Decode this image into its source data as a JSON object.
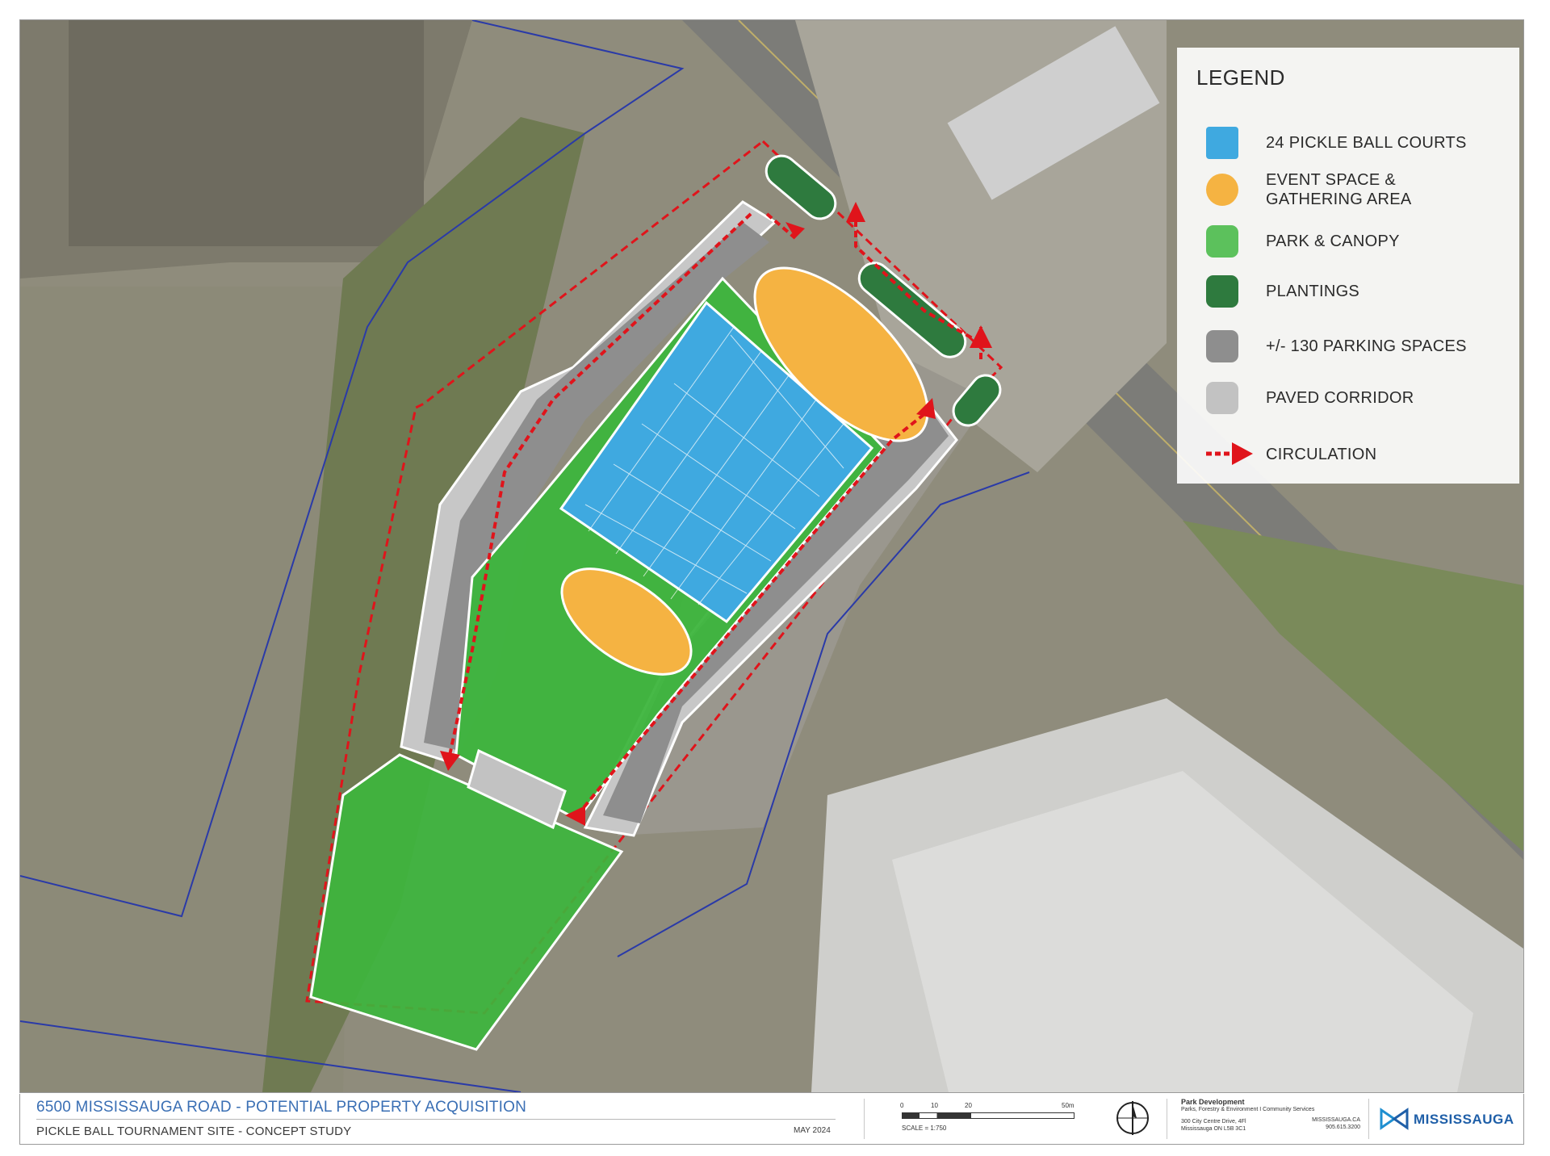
{
  "legend": {
    "title": "LEGEND",
    "items": [
      {
        "label": "24 PICKLE BALL COURTS",
        "color": "#3fa9e0",
        "icon": "pickleball-courts-swatch"
      },
      {
        "label": "EVENT SPACE &\nGATHERING AREA",
        "color": "#f5b342",
        "icon": "event-space-swatch"
      },
      {
        "label": "PARK & CANOPY",
        "color": "#5cc15c",
        "icon": "park-canopy-swatch"
      },
      {
        "label": "PLANTINGS",
        "color": "#2e7a3e",
        "icon": "plantings-swatch"
      },
      {
        "label": "+/- 130 PARKING SPACES",
        "color": "#8e8e8e",
        "icon": "parking-swatch"
      },
      {
        "label": "PAVED CORRIDOR",
        "color": "#c2c2c2",
        "icon": "paved-corridor-swatch"
      },
      {
        "label": "CIRCULATION",
        "color": "#e0141b",
        "icon": "circulation-arrow-icon"
      }
    ]
  },
  "title_block": {
    "title": "6500 MISSISSAUGA ROAD - POTENTIAL PROPERTY ACQUISITION",
    "subtitle": "PICKLE BALL TOURNAMENT SITE - CONCEPT STUDY",
    "date": "MAY 2024",
    "scale_ticks": [
      "0",
      "10",
      "20",
      "50m"
    ],
    "scale_label": "SCALE = 1:750",
    "department": "Park Development",
    "division": "Parks, Forestry & Environment I Community Services",
    "address_line1": "300 City Centre Drive, 4Fl",
    "address_line2": "Mississauga ON  L5B 3C1",
    "website": "MISSISSAUGA.CA",
    "phone": "905.615.3200",
    "logo_text": "MISSISSAUGA"
  }
}
